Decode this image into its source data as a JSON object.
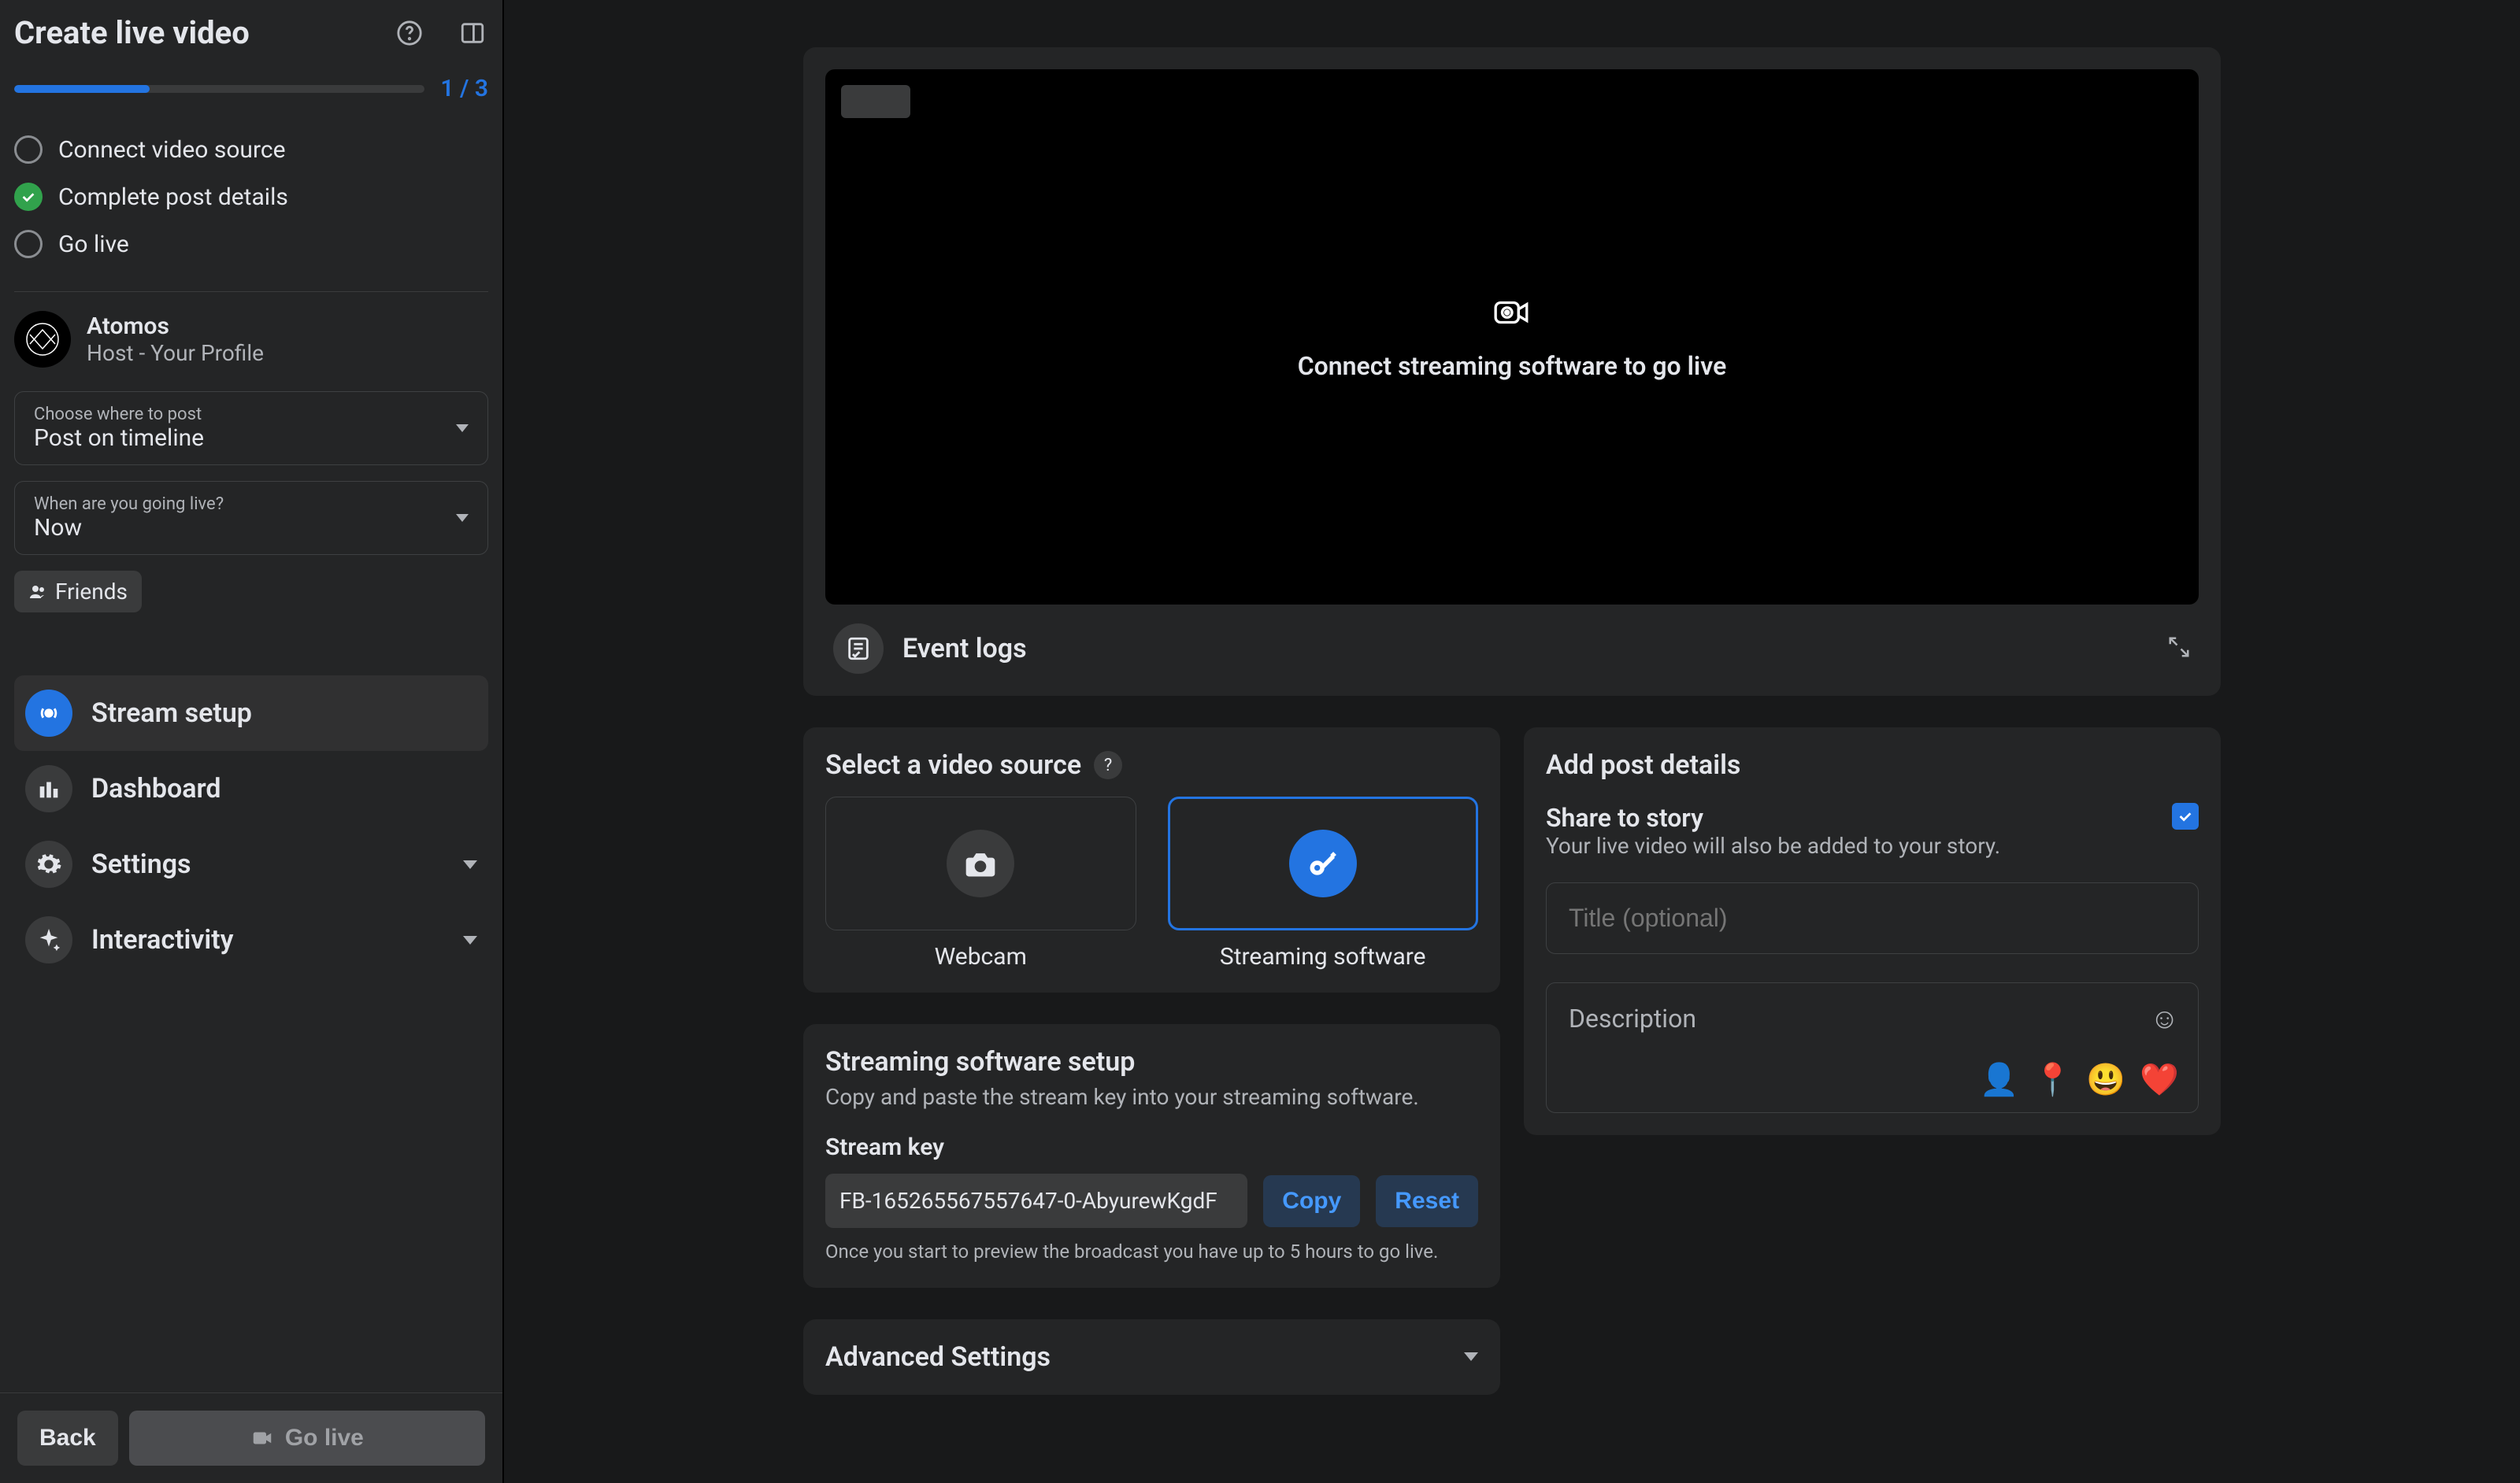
{
  "sidebar": {
    "title": "Create live video",
    "progress": {
      "text": "1 / 3",
      "percent": 33
    },
    "steps": [
      {
        "label": "Connect video source",
        "state": "empty"
      },
      {
        "label": "Complete post details",
        "state": "done"
      },
      {
        "label": "Go live",
        "state": "empty"
      }
    ],
    "profile": {
      "name": "Atomos",
      "subtitle": "Host - Your Profile"
    },
    "where": {
      "label": "Choose where to post",
      "value": "Post on timeline"
    },
    "when": {
      "label": "When are you going live?",
      "value": "Now"
    },
    "friends_label": "Friends",
    "nav": {
      "stream_setup": "Stream setup",
      "dashboard": "Dashboard",
      "settings": "Settings",
      "interactivity": "Interactivity"
    },
    "footer": {
      "back": "Back",
      "go_live": "Go live"
    }
  },
  "preview": {
    "center_text": "Connect streaming software to go live",
    "event_logs": "Event logs"
  },
  "video_source": {
    "title": "Select a video source",
    "webcam": "Webcam",
    "streaming": "Streaming software"
  },
  "stream_setup_panel": {
    "title": "Streaming software setup",
    "subtitle": "Copy and paste the stream key into your streaming software.",
    "key_label": "Stream key",
    "key_value": "FB-165265567557647-0-AbyurewKgdF",
    "copy": "Copy",
    "reset": "Reset",
    "hint": "Once you start to preview the broadcast you have up to 5 hours to go live.",
    "advanced": "Advanced Settings"
  },
  "post_details": {
    "title": "Add post details",
    "share_title": "Share to story",
    "share_sub": "Your live video will also be added to your story.",
    "title_placeholder": "Title (optional)",
    "desc_placeholder": "Description"
  }
}
